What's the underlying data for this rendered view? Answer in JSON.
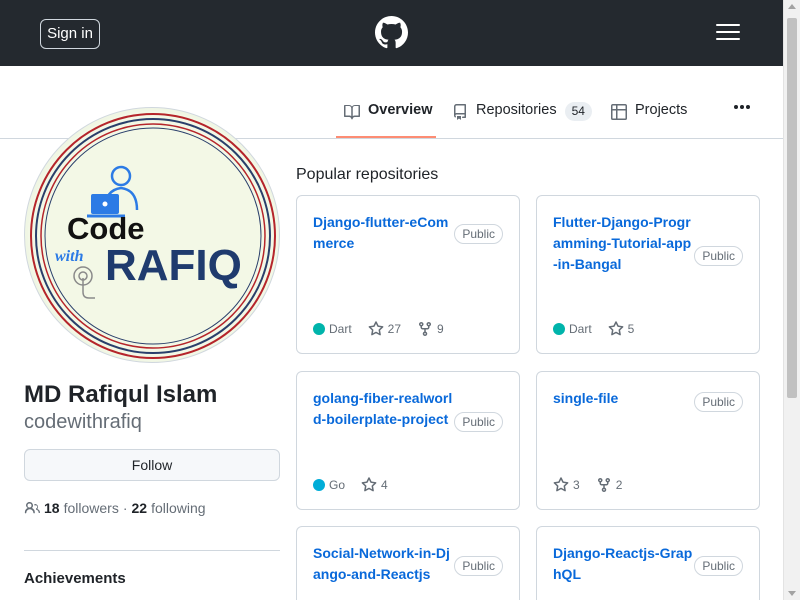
{
  "header": {
    "signin_label": "Sign in",
    "logo_icon": "github-mark-icon",
    "menu_icon": "hamburger-menu-icon",
    "background": "#24292f"
  },
  "tabs": [
    {
      "label": "Overview",
      "icon": "book-icon",
      "active": true
    },
    {
      "label": "Repositories",
      "icon": "repo-icon",
      "count": "54"
    },
    {
      "label": "Projects",
      "icon": "table-icon"
    }
  ],
  "profile": {
    "avatar_text_top": "Code",
    "avatar_text_with": "with",
    "avatar_text_name": "RAFIQ",
    "name": "MD Rafiqul Islam",
    "login": "codewithrafiq",
    "follow_label": "Follow",
    "followers_count": "18",
    "followers_label": "followers",
    "separator": "·",
    "following_count": "22",
    "following_label": "following",
    "achievements_heading": "Achievements"
  },
  "popular": {
    "heading": "Popular repositories",
    "repos": [
      {
        "name": "Django-flutter-eCommerce",
        "visibility": "Public",
        "language": "Dart",
        "language_color": "#00B4AB",
        "stars": "27",
        "forks": "9"
      },
      {
        "name": "Flutter-Django-Programming-Tutorial-app-in-Bangal",
        "visibility": "Public",
        "language": "Dart",
        "language_color": "#00B4AB",
        "stars": "5",
        "forks": ""
      },
      {
        "name": "golang-fiber-realworld-boilerplate-project",
        "visibility": "Public",
        "language": "Go",
        "language_color": "#00ADD8",
        "stars": "4",
        "forks": ""
      },
      {
        "name": "single-file",
        "visibility": "Public",
        "language": "",
        "language_color": "",
        "stars": "3",
        "forks": "2"
      },
      {
        "name": "Social-Network-in-Django-and-Reactjs",
        "visibility": "Public"
      },
      {
        "name": "Django-Reactjs-GraphQL",
        "visibility": "Public"
      }
    ]
  },
  "colors": {
    "link": "#0969da",
    "muted": "#656d76",
    "active_tab_underline": "#fd8c73"
  }
}
